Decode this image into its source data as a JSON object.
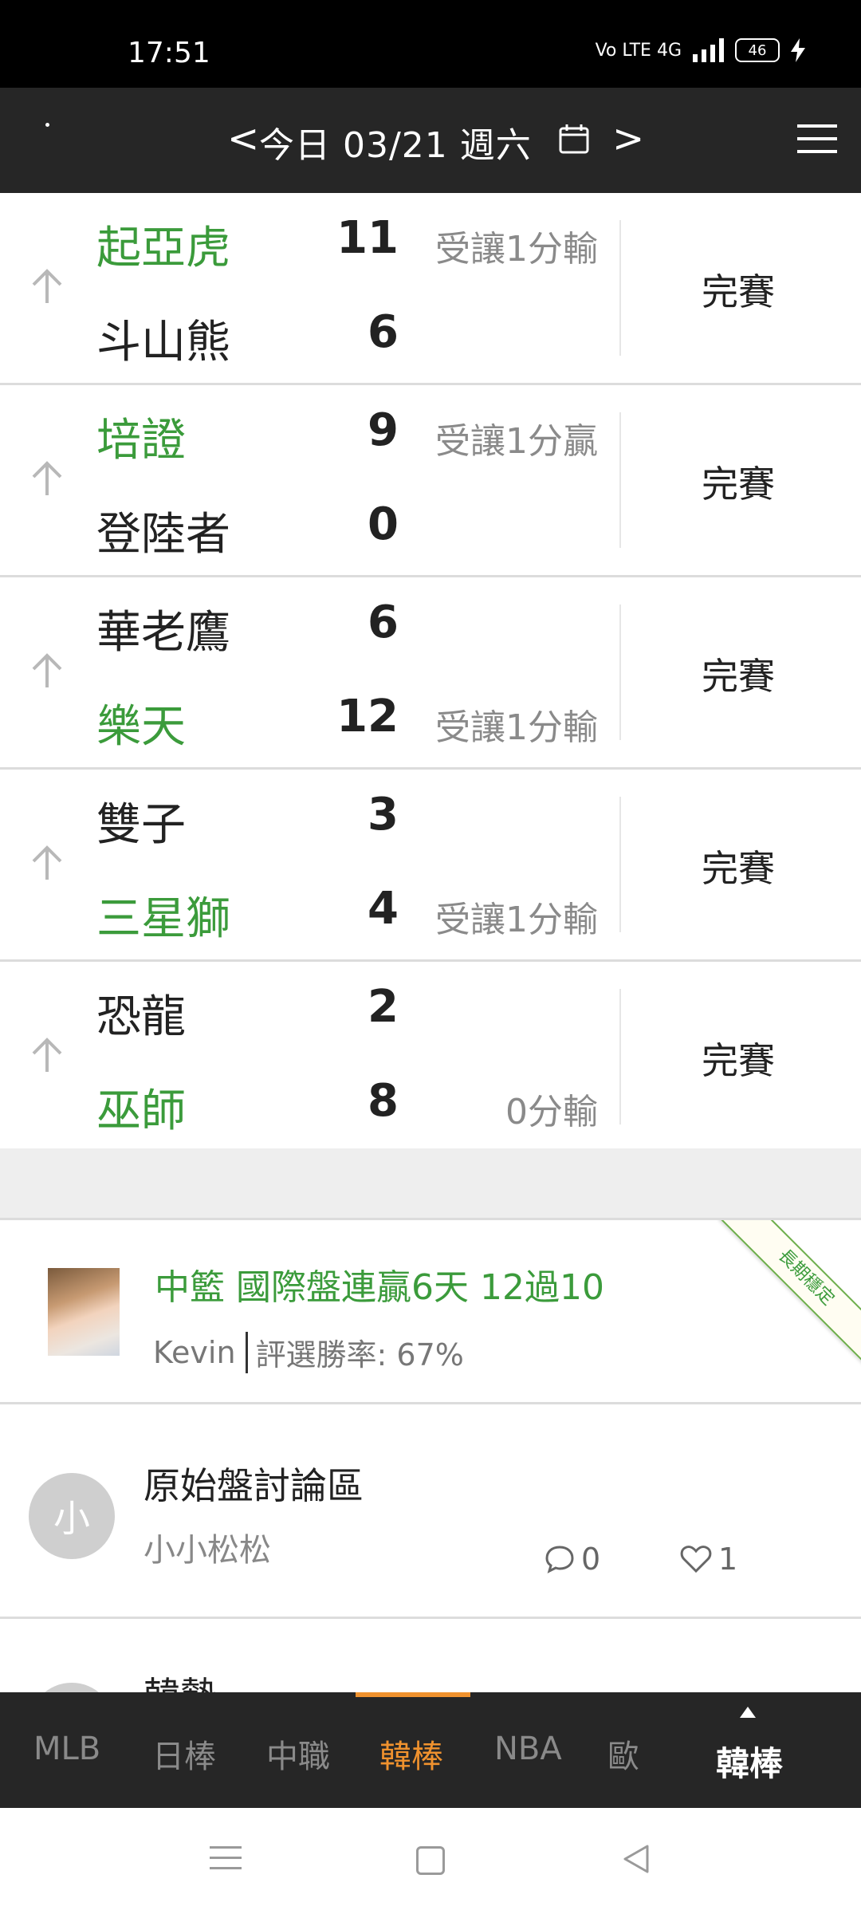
{
  "status_bar": {
    "time": "17:51",
    "network": "Vo LTE 4G",
    "battery": "46"
  },
  "header": {
    "prev": "<",
    "date": "今日 03/21 週六",
    "next": ">"
  },
  "games": [
    {
      "team1": "起亞虎",
      "score1": "11",
      "note1": "受讓1分輸",
      "team2": "斗山熊",
      "score2": "6",
      "note2": "",
      "status": "完賽",
      "winner": 1
    },
    {
      "team1": "培證",
      "score1": "9",
      "note1": "受讓1分贏",
      "team2": "登陸者",
      "score2": "0",
      "note2": "",
      "status": "完賽",
      "winner": 1
    },
    {
      "team1": "華老鷹",
      "score1": "6",
      "note1": "",
      "team2": "樂天",
      "score2": "12",
      "note2": "受讓1分輸",
      "status": "完賽",
      "winner": 2
    },
    {
      "team1": "雙子",
      "score1": "3",
      "note1": "",
      "team2": "三星獅",
      "score2": "4",
      "note2": "受讓1分輸",
      "status": "完賽",
      "winner": 2
    },
    {
      "team1": "恐龍",
      "score1": "2",
      "note1": "",
      "team2": "巫師",
      "score2": "8",
      "note2": "0分輸",
      "status": "完賽",
      "winner": 2
    }
  ],
  "featured": {
    "title": "中籃 國際盤連贏6天 12過10",
    "author": "Kevin",
    "rate": "評選勝率: 67%",
    "ribbon": "長期穩定"
  },
  "forum": {
    "avatar": "小",
    "title": "原始盤討論區",
    "author": "小小松松",
    "comments": "0",
    "likes": "1"
  },
  "peek_title": "韓勢",
  "tabs": [
    "MLB",
    "日棒",
    "中職",
    "韓棒",
    "NBA",
    "歐"
  ],
  "active_tab": "韓棒",
  "current_league": "韓棒",
  "colors": {
    "win": "#3b9b3b",
    "accent": "#f0922e",
    "header_bg": "#262626"
  }
}
